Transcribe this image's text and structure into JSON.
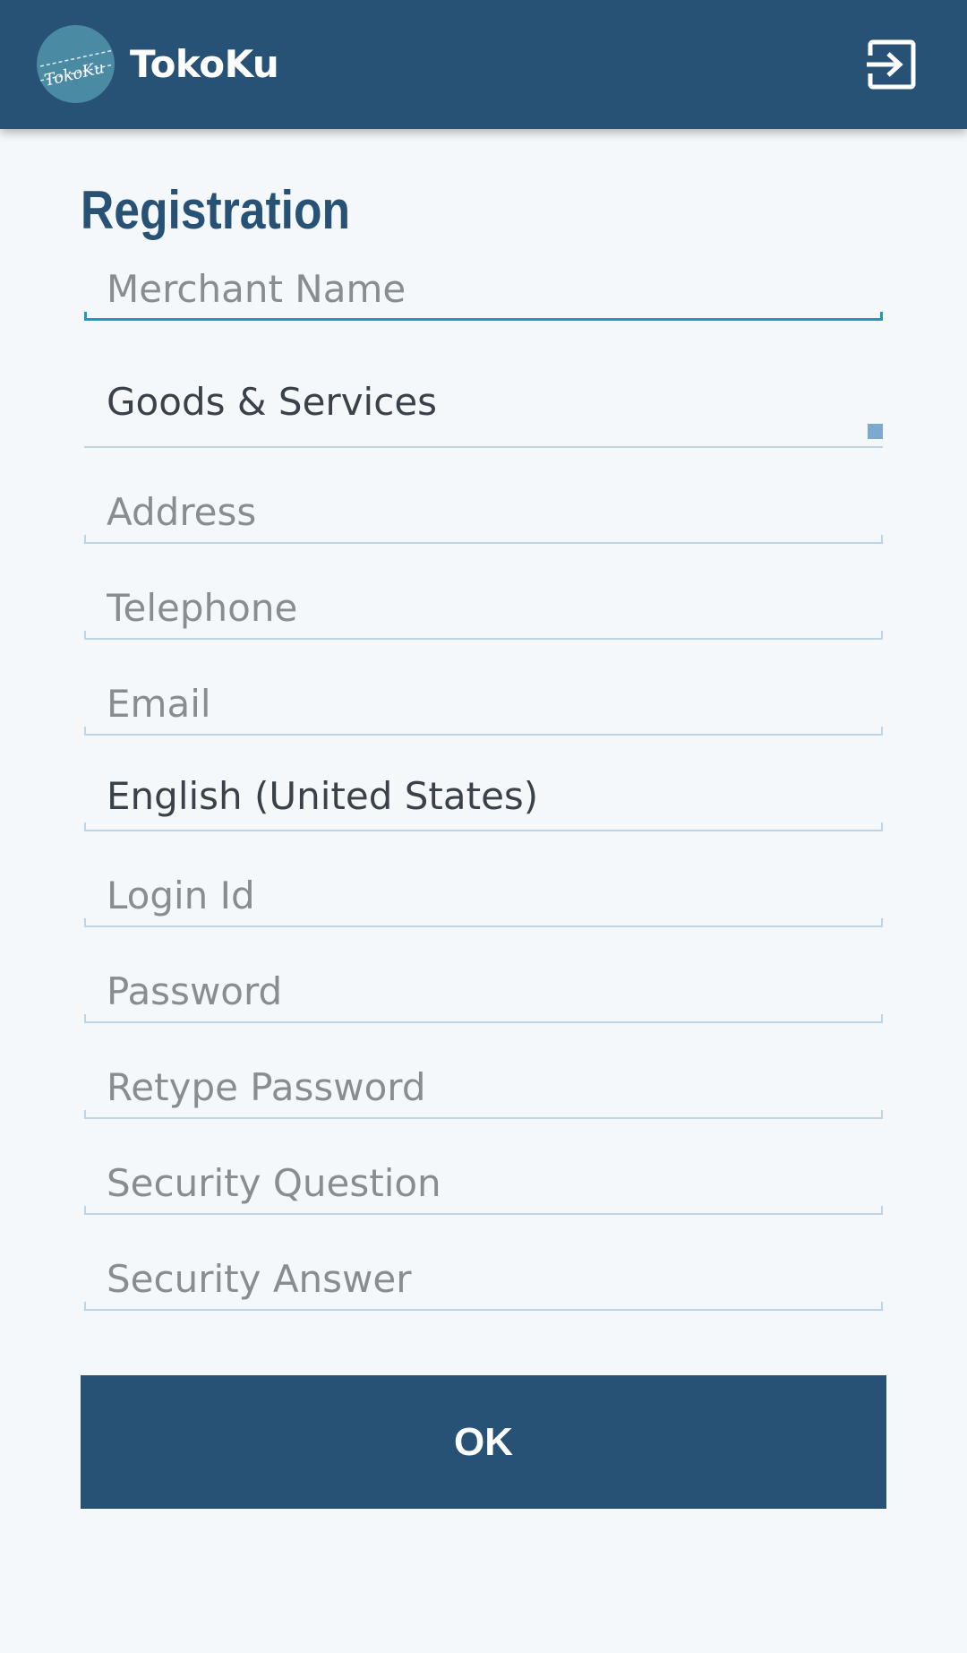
{
  "app": {
    "title": "TokoKu",
    "logo_text": "TokoKu",
    "logout_icon": "logout-icon"
  },
  "page": {
    "title": "Registration"
  },
  "form": {
    "merchant_name": {
      "placeholder": "Merchant Name",
      "value": ""
    },
    "category": {
      "value": "Goods & Services"
    },
    "address": {
      "placeholder": "Address",
      "value": ""
    },
    "telephone": {
      "placeholder": "Telephone",
      "value": ""
    },
    "email": {
      "placeholder": "Email",
      "value": ""
    },
    "language": {
      "value": "English (United States)"
    },
    "login_id": {
      "placeholder": "Login Id",
      "value": ""
    },
    "password": {
      "placeholder": "Password",
      "value": ""
    },
    "retype_password": {
      "placeholder": "Retype Password",
      "value": ""
    },
    "security_question": {
      "placeholder": "Security Question",
      "value": ""
    },
    "security_answer": {
      "placeholder": "Security Answer",
      "value": ""
    }
  },
  "actions": {
    "ok_label": "OK"
  },
  "colors": {
    "primary": "#285275",
    "accent": "#1a9bc6",
    "background": "#f4f8fb",
    "underline": "#bfd5e6"
  }
}
